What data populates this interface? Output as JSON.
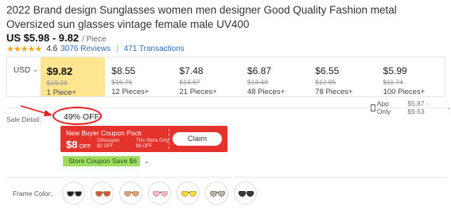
{
  "product": {
    "title": "2022 Brand design Sunglasses women men designer Good Quality Fashion metal Oversized sun glasses vintage female male UV400",
    "price_range": "US $5.98 - 9.82",
    "unit": "/ Piece",
    "rating_value": "4.6",
    "reviews_label": "3076 Reviews",
    "transactions_label": "471 Transactions"
  },
  "tiers": {
    "currency": "USD",
    "items": [
      {
        "price": "$9.82",
        "old": "$19.26",
        "qty": "1 Piece+"
      },
      {
        "price": "$8.55",
        "old": "$16.76",
        "qty": "12 Pieces+"
      },
      {
        "price": "$7.48",
        "old": "$14.67",
        "qty": "21 Pieces+"
      },
      {
        "price": "$6.87",
        "old": "$13.48",
        "qty": "48 Pieces+"
      },
      {
        "price": "$6.55",
        "old": "$12.85",
        "qty": "78 Pieces+"
      },
      {
        "price": "$5.99",
        "old": "$11.74",
        "qty": "100 Pieces+"
      }
    ]
  },
  "app_only": {
    "label": "App Only",
    "range": "$5.87 - $9.63"
  },
  "sale": {
    "label": "Sale Detail:",
    "discount": "49% OFF",
    "coupon": {
      "title": "New Buyer Coupon Pack",
      "amount": "$8",
      "amount_suffix": "OFF",
      "d1_line1": "DHcoupon",
      "d1_line2": "$2 OFF",
      "d2_line1": "This Store Only",
      "d2_line2": "$6 OFF",
      "claim": "Claim"
    },
    "store_coupon": "Store Coupon Save $6"
  },
  "frame": {
    "label": "Frame Color:",
    "swatches": [
      {
        "lens": "#1d1d1d",
        "frame": "#8a8a8a"
      },
      {
        "lens": "#c85b3a",
        "frame": "#b88a5a"
      },
      {
        "lens": "#d9a07a",
        "frame": "#c9a27a"
      },
      {
        "lens": "#f3b8bf",
        "frame": "#d8a0a8"
      },
      {
        "lens": "#f2dd3a",
        "frame": "#c8a838"
      },
      {
        "lens": "#b9b3a8",
        "frame": "#8f8a80"
      },
      {
        "lens": "#3b3b3b",
        "frame": "#1e1e1e"
      }
    ]
  },
  "colors": {
    "accent": "#e4332c",
    "highlight": "#fde68f",
    "link": "#2d6cc0",
    "star": "#f5a623",
    "store_tag": "#9fdc5f"
  }
}
